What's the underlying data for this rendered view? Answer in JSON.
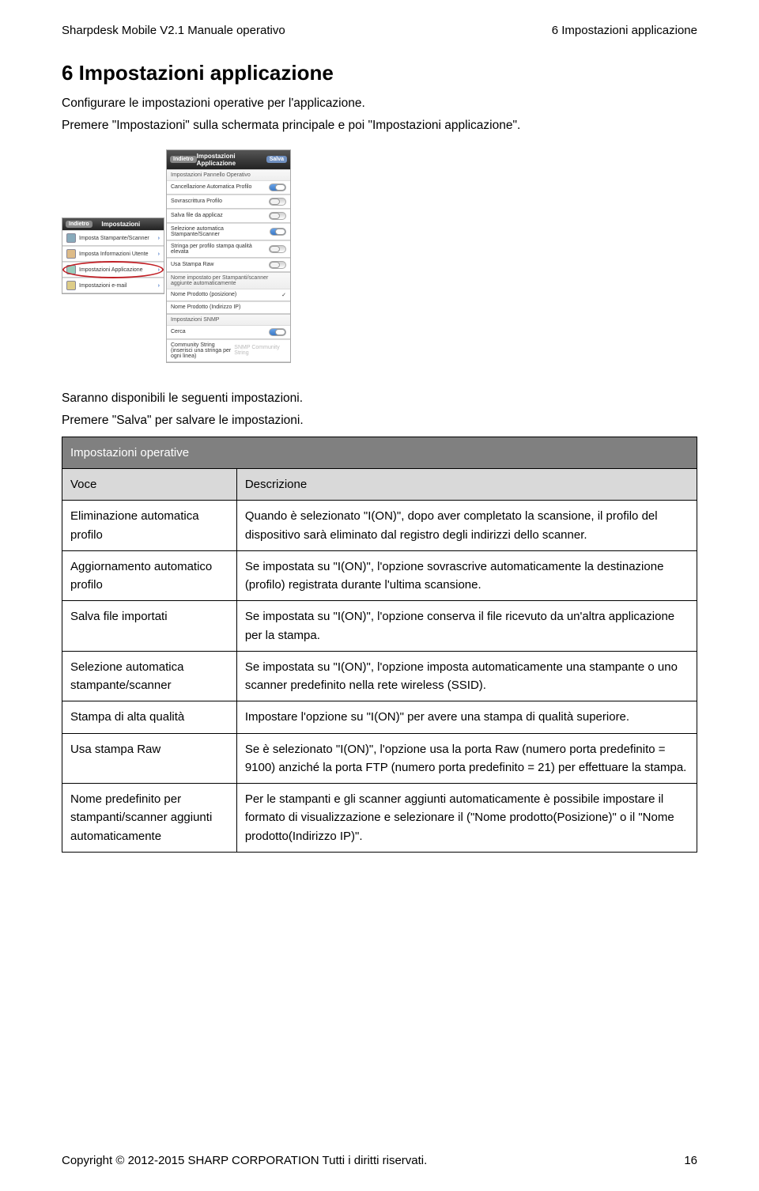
{
  "header": {
    "left": "Sharpdesk Mobile V2.1 Manuale operativo",
    "right": "6 Impostazioni applicazione"
  },
  "title": "6   Impostazioni applicazione",
  "intro_lines": [
    "Configurare le impostazioni operative per l'applicazione.",
    "Premere \"Impostazioni\" sulla schermata principale e poi \"Impostazioni applicazione\"."
  ],
  "figure": {
    "left_panel": {
      "titlebar_back": "Indietro",
      "titlebar_title": "Impostazioni",
      "items": [
        "Imposta Stampante/Scanner",
        "Imposta Informazioni Utente",
        "Impostazioni Applicazione",
        "Impostazioni e-mail"
      ],
      "circled_index": 2
    },
    "right_panel": {
      "titlebar_back": "Indietro",
      "titlebar_title": "Impostazioni Applicazione",
      "titlebar_action": "Salva",
      "section1": "Impostazioni Pannello Operativo",
      "rows1": [
        {
          "label": "Cancellazione Automatica Profilo",
          "toggle": "on"
        },
        {
          "label": "Sovrascrittura Profilo",
          "toggle": "off"
        },
        {
          "label": "Salva file da applicaz",
          "toggle": "off"
        },
        {
          "label": "Selezione automatica Stampante/Scanner",
          "toggle": "on"
        },
        {
          "label": "Stringa per profilo stampa qualità elevata",
          "toggle": "off"
        },
        {
          "label": "Usa Stampa Raw",
          "toggle": "off"
        }
      ],
      "section2": "Nome impostato per Stampanti/scanner aggiunte automaticamente",
      "rows2": [
        {
          "label": "Nome Prodotto (posizione)",
          "check": true
        },
        {
          "label": "Nome Prodotto (Indirizzo IP)",
          "check": false
        }
      ],
      "section3": "Impostazioni SNMP",
      "rows3": [
        {
          "label": "Cerca",
          "toggle": "on"
        },
        {
          "label": "Community String (inserisci una stringa per ogni linea)",
          "value": "SNMP Community String"
        }
      ]
    }
  },
  "post_figure_lines": [
    "Saranno disponibili le seguenti impostazioni.",
    "Premere \"Salva\" per salvare le impostazioni."
  ],
  "table": {
    "group_header": "Impostazioni operative",
    "col_headers": {
      "voce": "Voce",
      "desc": "Descrizione"
    },
    "rows": [
      {
        "voce": "Eliminazione automatica profilo",
        "desc": "Quando è selezionato \"I(ON)\", dopo aver completato la scansione, il profilo del dispositivo sarà eliminato dal registro degli indirizzi dello scanner."
      },
      {
        "voce": "Aggiornamento automatico profilo",
        "desc": "Se impostata su \"I(ON)\", l'opzione sovrascrive automaticamente la destinazione (profilo) registrata durante l'ultima scansione."
      },
      {
        "voce": "Salva file importati",
        "desc": "Se impostata su \"I(ON)\", l'opzione conserva il file ricevuto da un'altra applicazione per la stampa."
      },
      {
        "voce": "Selezione automatica stampante/scanner",
        "desc": "Se impostata su \"I(ON)\", l'opzione imposta automaticamente una stampante o uno scanner predefinito nella rete wireless (SSID)."
      },
      {
        "voce": "Stampa di alta qualità",
        "desc": "Impostare l'opzione su \"I(ON)\" per avere una stampa di qualità superiore."
      },
      {
        "voce": "Usa stampa Raw",
        "desc": "Se è selezionato \"I(ON)\", l'opzione usa la porta Raw (numero porta predefinito = 9100) anziché la porta FTP (numero porta predefinito = 21) per effettuare la stampa."
      },
      {
        "voce": "Nome predefinito per stampanti/scanner aggiunti automaticamente",
        "desc": "Per le stampanti e gli scanner aggiunti automaticamente è possibile impostare il formato di visualizzazione e selezionare il (\"Nome prodotto(Posizione)\" o il \"Nome prodotto(Indirizzo IP)\"."
      }
    ]
  },
  "footer": {
    "left": "Copyright © 2012-2015 SHARP CORPORATION Tutti i diritti riservati.",
    "right": "16"
  }
}
